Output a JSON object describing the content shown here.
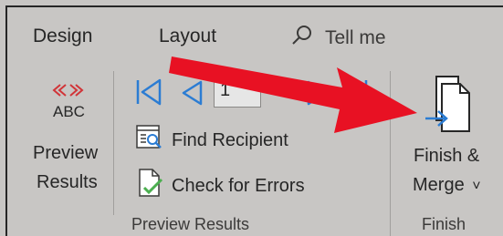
{
  "tabs": {
    "design": "Design",
    "layout": "Layout"
  },
  "tell_me": {
    "label": "Tell me"
  },
  "preview_results_group": {
    "abc_label": "ABC",
    "preview_button_line1": "Preview",
    "preview_button_line2": "Results",
    "record_number": "1",
    "find_recipient_label": "Find Recipient",
    "check_errors_label": "Check for Errors",
    "group_label": "Preview Results"
  },
  "finish_group": {
    "finish_merge_line1": "Finish &",
    "finish_merge_line2": "Merge",
    "dropdown_glyph": "˅",
    "group_label": "Finish"
  },
  "colors": {
    "ribbon_bg": "#c8c6c4",
    "nav_blue": "#2b7cd3",
    "annotation_red": "#e81123",
    "chevron_red": "#d13438",
    "check_green": "#4caf50"
  }
}
